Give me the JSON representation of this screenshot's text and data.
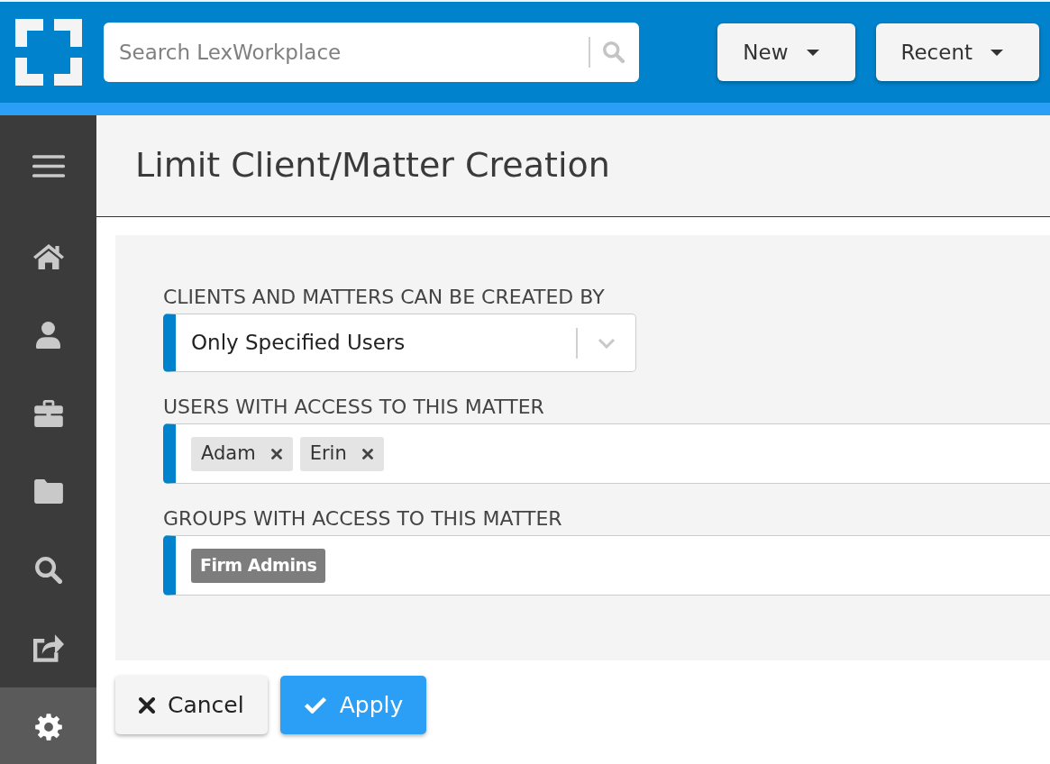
{
  "topbar": {
    "search": {
      "placeholder": "Search LexWorkplace"
    },
    "buttons": [
      {
        "label": "New"
      },
      {
        "label": "Recent"
      }
    ]
  },
  "sidebar": {
    "items": [
      {
        "kind": "home",
        "selected": false
      },
      {
        "kind": "user",
        "selected": false
      },
      {
        "kind": "briefcase",
        "selected": false
      },
      {
        "kind": "folder",
        "selected": false
      },
      {
        "kind": "search",
        "selected": false
      },
      {
        "kind": "share",
        "selected": false
      },
      {
        "kind": "settings",
        "selected": true
      }
    ]
  },
  "page": {
    "title": "Limit Client/Matter Creation"
  },
  "form": {
    "fields": [
      {
        "kind": "select",
        "label": "CLIENTS AND MATTERS CAN BE CREATED BY",
        "value": "Only Specified Users"
      },
      {
        "kind": "tags",
        "label": "USERS WITH ACCESS TO THIS MATTER",
        "tags": [
          {
            "label": "Adam",
            "removable": true
          },
          {
            "label": "Erin",
            "removable": true
          }
        ]
      },
      {
        "kind": "tags",
        "label": "GROUPS WITH ACCESS TO THIS MATTER",
        "tags": [
          {
            "label": "Firm Admins",
            "removable": false
          }
        ]
      }
    ]
  },
  "actions": [
    {
      "kind": "cancel",
      "label": "Cancel"
    },
    {
      "kind": "apply",
      "label": "Apply"
    }
  ]
}
